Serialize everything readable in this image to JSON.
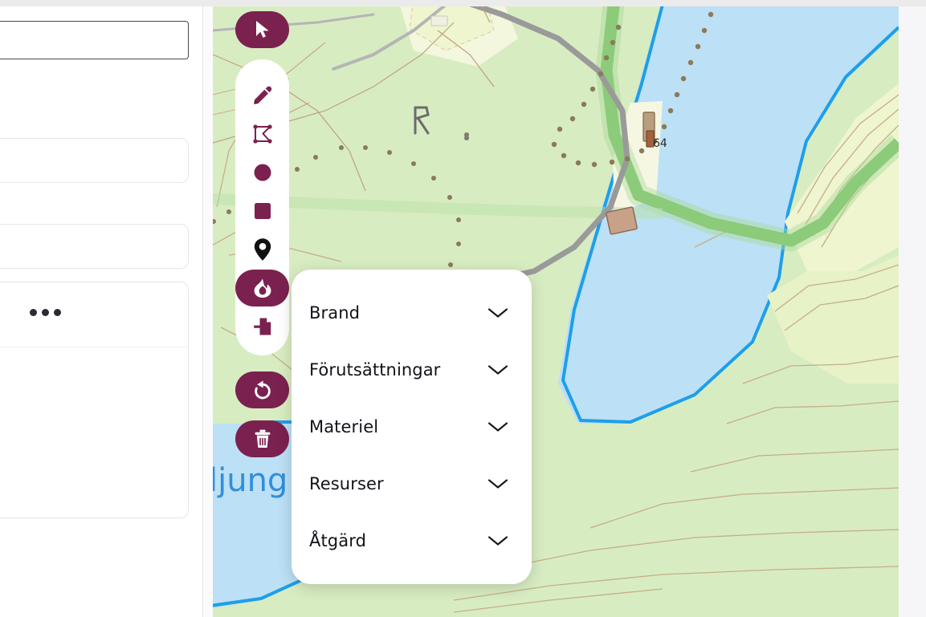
{
  "app": {
    "accent_color": "#7b2150",
    "panel_bg": "#ffffff",
    "map_water_color": "#bce0f5",
    "map_shore_color": "#1e9fe8",
    "map_land_color": "#d8ecc2",
    "map_open_color": "#eef5cf",
    "map_road_color": "#9a9a9a",
    "map_contour_color": "#c6ae85",
    "map_path_green": "#76c060"
  },
  "sidebar": {
    "input_value": "",
    "input_placeholder": "",
    "card_a_text": "",
    "card_b_text": "",
    "card_c_menu_label": "•••"
  },
  "toolbar": {
    "cursor": {
      "label": "Markera",
      "icon": "cursor-arrow-icon",
      "active": false
    },
    "tools": [
      {
        "label": "Rita",
        "icon": "pencil-icon",
        "active": false
      },
      {
        "label": "Polygon",
        "icon": "polygon-vertices-icon",
        "active": false
      },
      {
        "label": "Cirkel",
        "icon": "circle-shape-icon",
        "active": false
      },
      {
        "label": "Rektangel",
        "icon": "square-shape-icon",
        "active": false
      },
      {
        "label": "Markör",
        "icon": "map-pin-icon",
        "active": false
      },
      {
        "label": "Brand",
        "icon": "flame-icon",
        "active": true
      },
      {
        "label": "Importera",
        "icon": "file-import-icon",
        "active": false
      }
    ],
    "undo": {
      "label": "Ångra",
      "icon": "undo-arrow-icon"
    },
    "trash": {
      "label": "Ta bort",
      "icon": "trash-icon"
    }
  },
  "menu": {
    "items": [
      {
        "label": "Brand",
        "icon": "chevron-down-icon",
        "expanded": false
      },
      {
        "label": "Förutsättningar",
        "icon": "chevron-down-icon",
        "expanded": false
      },
      {
        "label": "Materiel",
        "icon": "chevron-down-icon",
        "expanded": false
      },
      {
        "label": "Resurser",
        "icon": "chevron-down-icon",
        "expanded": false
      },
      {
        "label": "Åtgärd",
        "icon": "chevron-down-icon",
        "expanded": false
      }
    ]
  },
  "map": {
    "road_number_label": "64",
    "water_label": "ljung"
  }
}
